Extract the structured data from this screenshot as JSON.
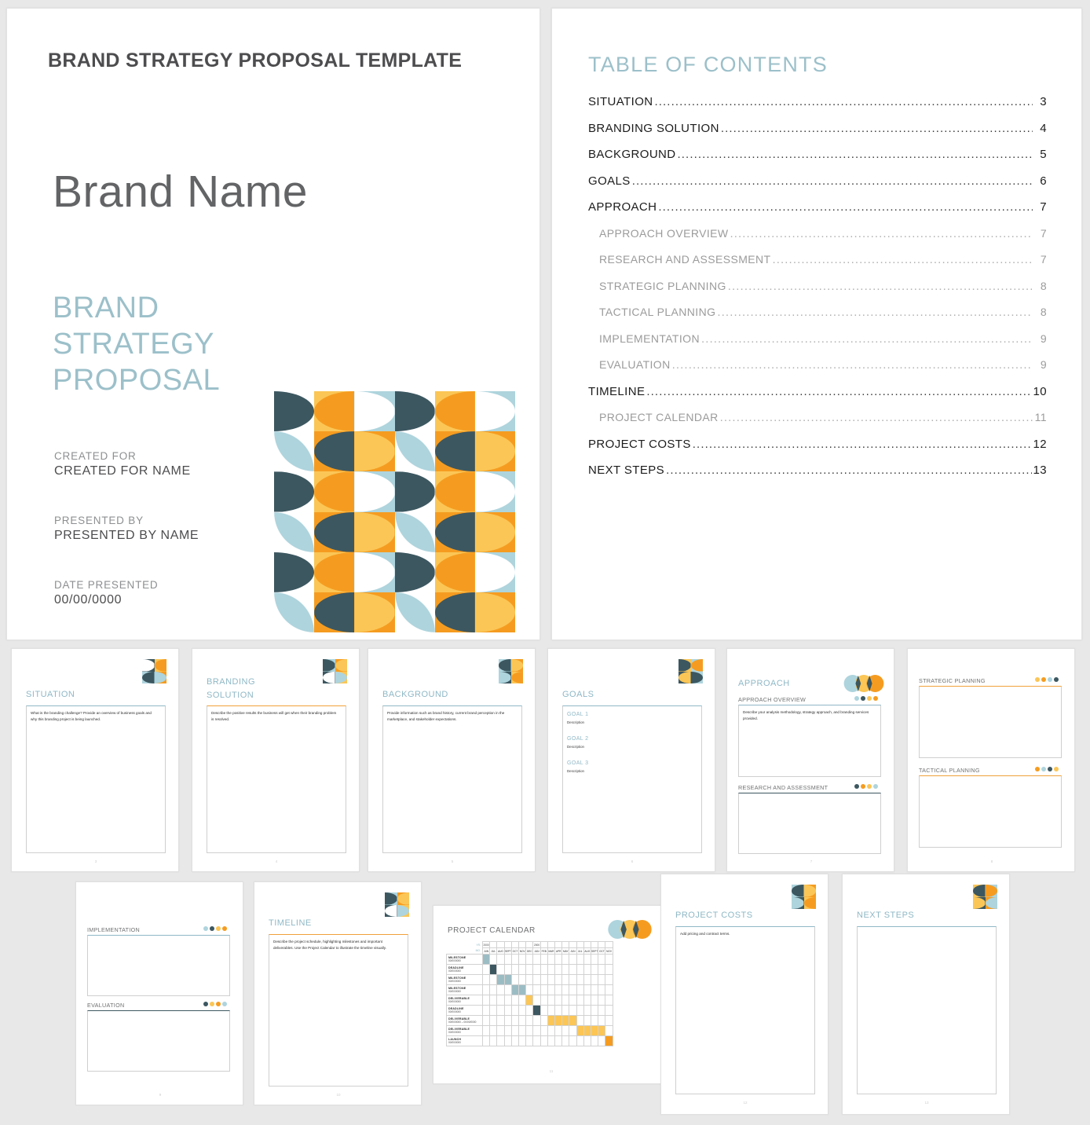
{
  "cover": {
    "kicker": "BRAND STRATEGY PROPOSAL TEMPLATE",
    "brand_name": "Brand Name",
    "subtitle_line1": "BRAND",
    "subtitle_line2": "STRATEGY",
    "subtitle_line3": "PROPOSAL",
    "created_for_label": "CREATED FOR",
    "created_for_value": "CREATED FOR NAME",
    "presented_by_label": "PRESENTED BY",
    "presented_by_value": "PRESENTED BY NAME",
    "date_presented_label": "DATE PRESENTED",
    "date_presented_value": "00/00/0000"
  },
  "toc": {
    "title": "TABLE OF CONTENTS",
    "entries": [
      {
        "label": "SITUATION",
        "page": "3",
        "sub": false
      },
      {
        "label": "BRANDING  SOLUTION",
        "page": "4",
        "sub": false
      },
      {
        "label": "BACKGROUND",
        "page": "5",
        "sub": false
      },
      {
        "label": "GOALS",
        "page": "6",
        "sub": false
      },
      {
        "label": "APPROACH",
        "page": "7",
        "sub": false
      },
      {
        "label": "APPROACH OVERVIEW",
        "page": "7",
        "sub": true
      },
      {
        "label": "RESEARCH AND ASSESSMENT",
        "page": "7",
        "sub": true
      },
      {
        "label": "STRATEGIC PLANNING",
        "page": "8",
        "sub": true
      },
      {
        "label": "TACTICAL PLANNING",
        "page": "8",
        "sub": true
      },
      {
        "label": "IMPLEMENTATION",
        "page": "9",
        "sub": true
      },
      {
        "label": "EVALUATION",
        "page": "9",
        "sub": true
      },
      {
        "label": "TIMELINE",
        "page": "10",
        "sub": false
      },
      {
        "label": "PROJECT CALENDAR",
        "page": "11",
        "sub": true
      },
      {
        "label": "PROJECT COSTS",
        "page": "12",
        "sub": false
      },
      {
        "label": "NEXT STEPS",
        "page": "13",
        "sub": false
      }
    ]
  },
  "pages": {
    "situation": {
      "title": "SITUATION",
      "body": "What is the branding challenge? Provide an overview of business goals and why this branding project is being launched.",
      "page_number": "3"
    },
    "branding_solution": {
      "title_line1": "BRANDING",
      "title_line2": "SOLUTION",
      "body": "Describe the positive results the business will get when their branding problem is resolved.",
      "page_number": "4"
    },
    "background": {
      "title": "BACKGROUND",
      "body": "Provide information such as brand history, current brand perception in the marketplace, and stakeholder expectations.",
      "page_number": "5"
    },
    "goals": {
      "title": "GOALS",
      "items": [
        {
          "title": "GOAL 1",
          "description": "Description"
        },
        {
          "title": "GOAL 2",
          "description": "Description"
        },
        {
          "title": "GOAL 3",
          "description": "Description"
        }
      ],
      "page_number": "6"
    },
    "approach": {
      "title": "APPROACH",
      "section1_title": "APPROACH OVERVIEW",
      "section1_body": "Describe your analysis methodology, strategy approach, and branding services provided.",
      "section2_title": "RESEARCH AND ASSESSMENT",
      "page_number": "7"
    },
    "strategic": {
      "section1_title": "STRATEGIC PLANNING",
      "section2_title": "TACTICAL PLANNING",
      "page_number": "8"
    },
    "implementation": {
      "section1_title": "IMPLEMENTATION",
      "section2_title": "EVALUATION",
      "page_number": "9"
    },
    "timeline": {
      "title": "TIMELINE",
      "body": "Describe the project schedule, highlighting milestones and important deliverables.  Use the Project Calendar to illustrate the timeline visually.",
      "page_number": "10"
    },
    "project_calendar": {
      "title": "PROJECT CALENDAR",
      "page_number": "11"
    },
    "project_costs": {
      "title": "PROJECT COSTS",
      "body": "Add pricing and contract terms.",
      "page_number": "12"
    },
    "next_steps": {
      "title": "NEXT STEPS",
      "page_number": "13"
    }
  },
  "calendar": {
    "year_label": "YR.",
    "month_label": "MO.",
    "years": [
      "2000",
      "2000"
    ],
    "months": [
      "JUN",
      "JUL",
      "AUG",
      "SEPT",
      "OCT",
      "NOV",
      "DEC",
      "JAN",
      "FEB",
      "MAR",
      "APR",
      "MAY",
      "JUN",
      "JUL",
      "AUG",
      "SEPT",
      "OCT",
      "NOV"
    ],
    "rows": [
      {
        "name": "MILESTONE",
        "date": "00/00/0000",
        "start": 0,
        "span": 1,
        "color": "#9cbcc4"
      },
      {
        "name": "DEADLINE",
        "date": "00/00/0000",
        "start": 1,
        "span": 1,
        "color": "#3c5760"
      },
      {
        "name": "MILESTONE",
        "date": "00/00/0000",
        "start": 2,
        "span": 2,
        "color": "#9cbcc4"
      },
      {
        "name": "MILESTONE",
        "date": "00/00/0000",
        "start": 4,
        "span": 2,
        "color": "#9cbcc4"
      },
      {
        "name": "DELIVERABLE",
        "date": "00/00/0000",
        "start": 6,
        "span": 1,
        "color": "#fbc656"
      },
      {
        "name": "DEADLINE",
        "date": "00/00/0000",
        "start": 7,
        "span": 1,
        "color": "#3c5760"
      },
      {
        "name": "DELIVERABLE",
        "date": "00/00/0000 – 00/00/0000",
        "start": 9,
        "span": 4,
        "color": "#fbc656"
      },
      {
        "name": "DELIVERABLE",
        "date": "00/00/0000",
        "start": 13,
        "span": 4,
        "color": "#fbc656"
      },
      {
        "name": "LAUNCH",
        "date": "00/00/0000",
        "start": 17,
        "span": 1,
        "color": "#f59c20"
      }
    ]
  },
  "palette": {
    "dark_teal": "#3c5760",
    "light_blue": "#aed4dd",
    "orange": "#f59c20",
    "yellow": "#fbc656",
    "white": "#ffffff",
    "heading_blue": "#8fb8c6",
    "text_gray": "#4d4d4f"
  }
}
